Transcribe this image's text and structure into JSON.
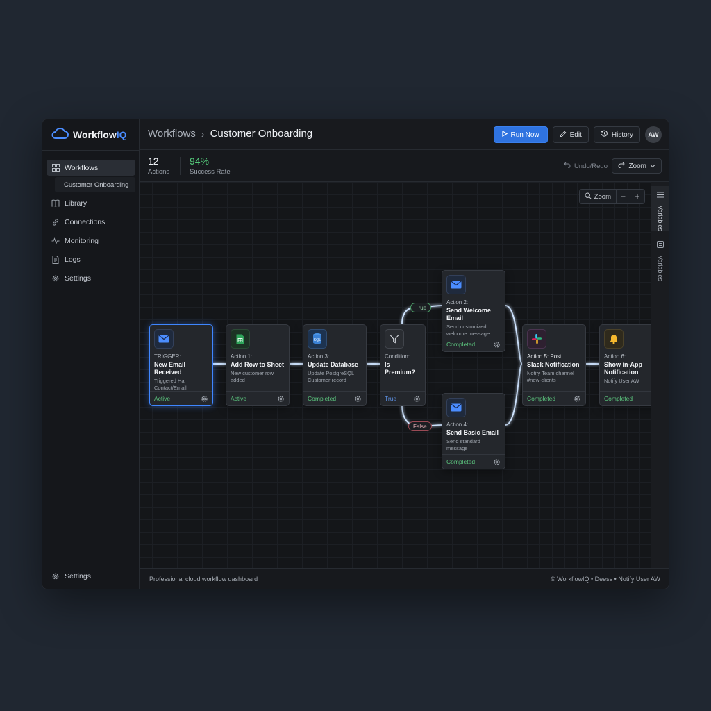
{
  "app": {
    "logo_main": "Workflow",
    "logo_accent": "IQ"
  },
  "sidebar": {
    "items": [
      {
        "label": "Workflows",
        "icon": "grid-icon"
      },
      {
        "label": "Library",
        "icon": "book-icon"
      },
      {
        "label": "Connections",
        "icon": "link-icon"
      },
      {
        "label": "Monitoring",
        "icon": "pulse-icon"
      },
      {
        "label": "Logs",
        "icon": "document-icon"
      },
      {
        "label": "Settings",
        "icon": "gear-icon"
      }
    ],
    "sub_item": "Customer Onboarding",
    "bottom_label": "Settings"
  },
  "header": {
    "breadcrumb_root": "Workflows",
    "breadcrumb_sep": "›",
    "page_title": "Customer Onboarding",
    "run_label": "Run Now",
    "edit_label": "Edit",
    "history_label": "History",
    "avatar_initials": "AW"
  },
  "stats": {
    "actions_value": "12",
    "actions_label": "Actions",
    "success_value": "94%",
    "success_label": "Success Rate",
    "undo_label": "Undo/Redo",
    "zoom_label": "Zoom"
  },
  "canvas": {
    "zoom_label": "Zoom",
    "zoom_out": "−",
    "zoom_in": "+",
    "true_tag": "True",
    "false_tag": "False"
  },
  "nodes": [
    {
      "kind": "TRIGGER:",
      "title": "New Email Received",
      "desc": "Triggered Ha Contact/Email",
      "status": "Active",
      "icon": "mail-icon"
    },
    {
      "kind": "Action 1:",
      "title": "Add Row to Sheet",
      "desc": "New customer row added",
      "status": "Active",
      "icon": "sheet-icon"
    },
    {
      "kind": "Action 3:",
      "title": "Update Database",
      "desc": "Update PostgreSQL Customer record",
      "status": "Completed",
      "icon": "database-icon",
      "icon_text": "SQL"
    },
    {
      "kind": "Condition:",
      "title": "Is Premium?",
      "desc": "",
      "status": "True",
      "icon": "filter-icon"
    },
    {
      "kind": "Action 2:",
      "title": "Send Welcome Email",
      "desc": "Send customized welcome message",
      "status": "Completed",
      "icon": "mail-icon"
    },
    {
      "kind": "Action 4:",
      "title": "Send Basic Email",
      "desc": "Send standard message",
      "status": "Completed",
      "icon": "mail-icon"
    },
    {
      "kind": "Action 5: Post",
      "title": "Slack Notification",
      "desc": "Notify Team channel #new-clients",
      "status": "Completed",
      "icon": "slack-icon"
    },
    {
      "kind": "Action 6:",
      "title": "Show in-App Notification",
      "desc": "Notify User AW",
      "status": "Completed",
      "icon": "bell-icon"
    }
  ],
  "rail": {
    "tab1": "Variables",
    "tab2": "Variables"
  },
  "footer": {
    "left": "Professional cloud workflow dashboard",
    "right": "© WorkflowIQ • Deess • Notify User AW"
  },
  "colors": {
    "accent": "#2f73e0",
    "success": "#53c879",
    "selected_border": "#3f86ff",
    "wire": "#cfe4ff"
  }
}
